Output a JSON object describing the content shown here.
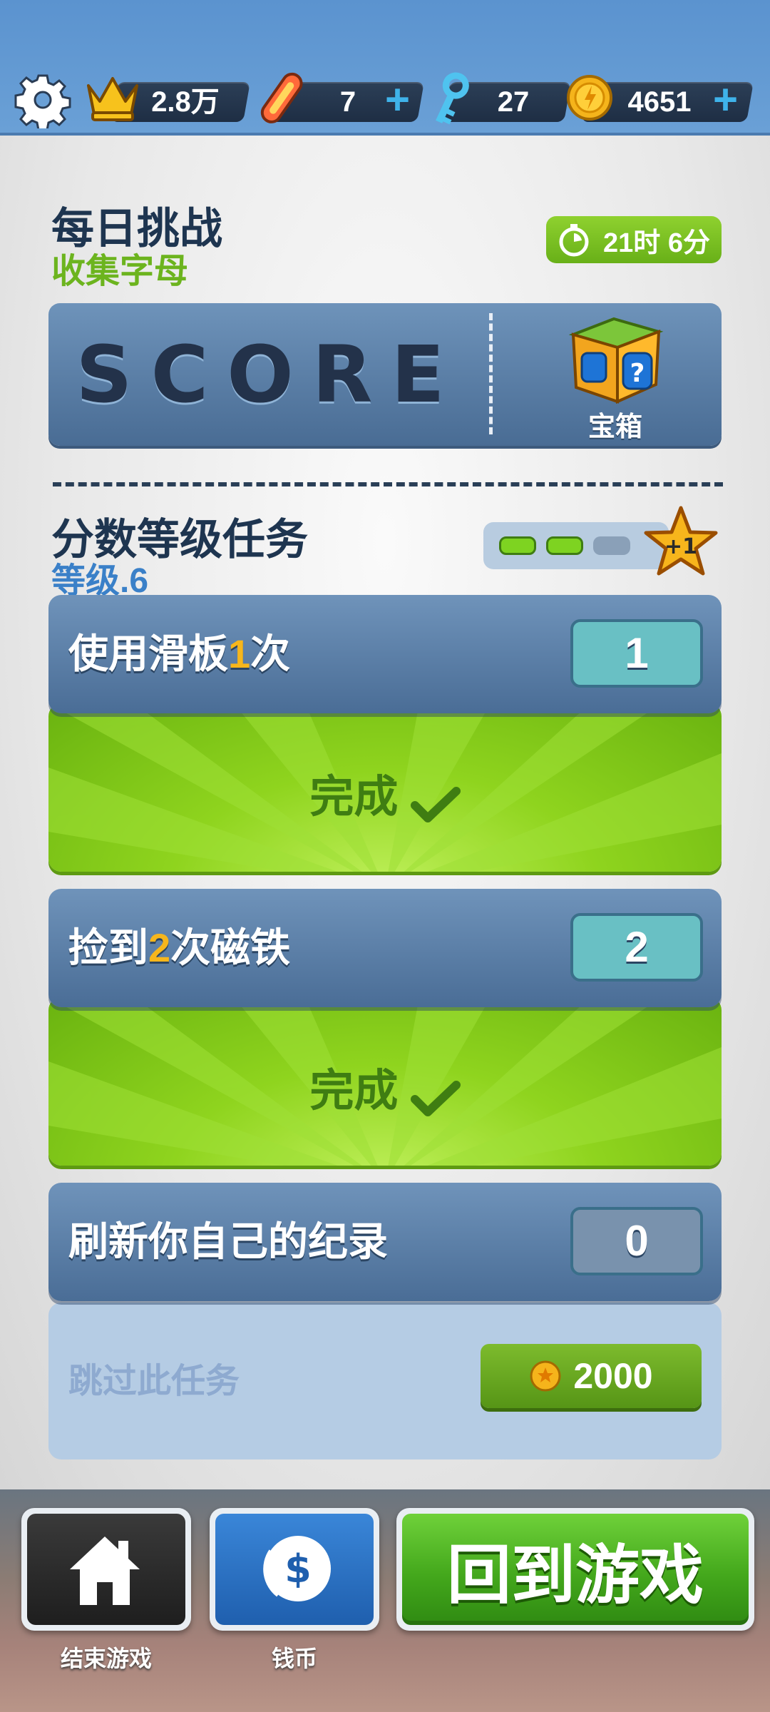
{
  "topbar": {
    "crown_value": "2.8万",
    "boards_value": "7",
    "keys_value": "27",
    "coins_value": "4651",
    "plus_symbol": "+",
    "colors": {
      "bar": "#5f98d2",
      "pill": "#24354c",
      "plus": "#3fb3ea",
      "coin": "#f5b41b"
    }
  },
  "challenge": {
    "title": "每日挑战",
    "subtitle": "收集字母",
    "timer": "21时 6分",
    "score_letters": "SCORE",
    "reward_label": "宝箱"
  },
  "missions": {
    "title": "分数等级任务",
    "level": "等级.6",
    "progress_filled": 2,
    "progress_total": 3,
    "star_bonus": "+1",
    "tasks": [
      {
        "pre": "使用滑板",
        "num": "1",
        "post": "次",
        "count": "1",
        "status": "完成"
      },
      {
        "pre": "捡到",
        "num": "2",
        "post": "次磁铁",
        "count": "2",
        "status": "完成"
      },
      {
        "pre": "刷新你自己的纪录",
        "num": "",
        "post": "",
        "count": "0",
        "skip_label": "跳过此任务",
        "skip_cost": "2000"
      }
    ]
  },
  "bottom": {
    "home_caption": "结束游戏",
    "coins_caption": "钱币",
    "return_label": "回到游戏"
  }
}
